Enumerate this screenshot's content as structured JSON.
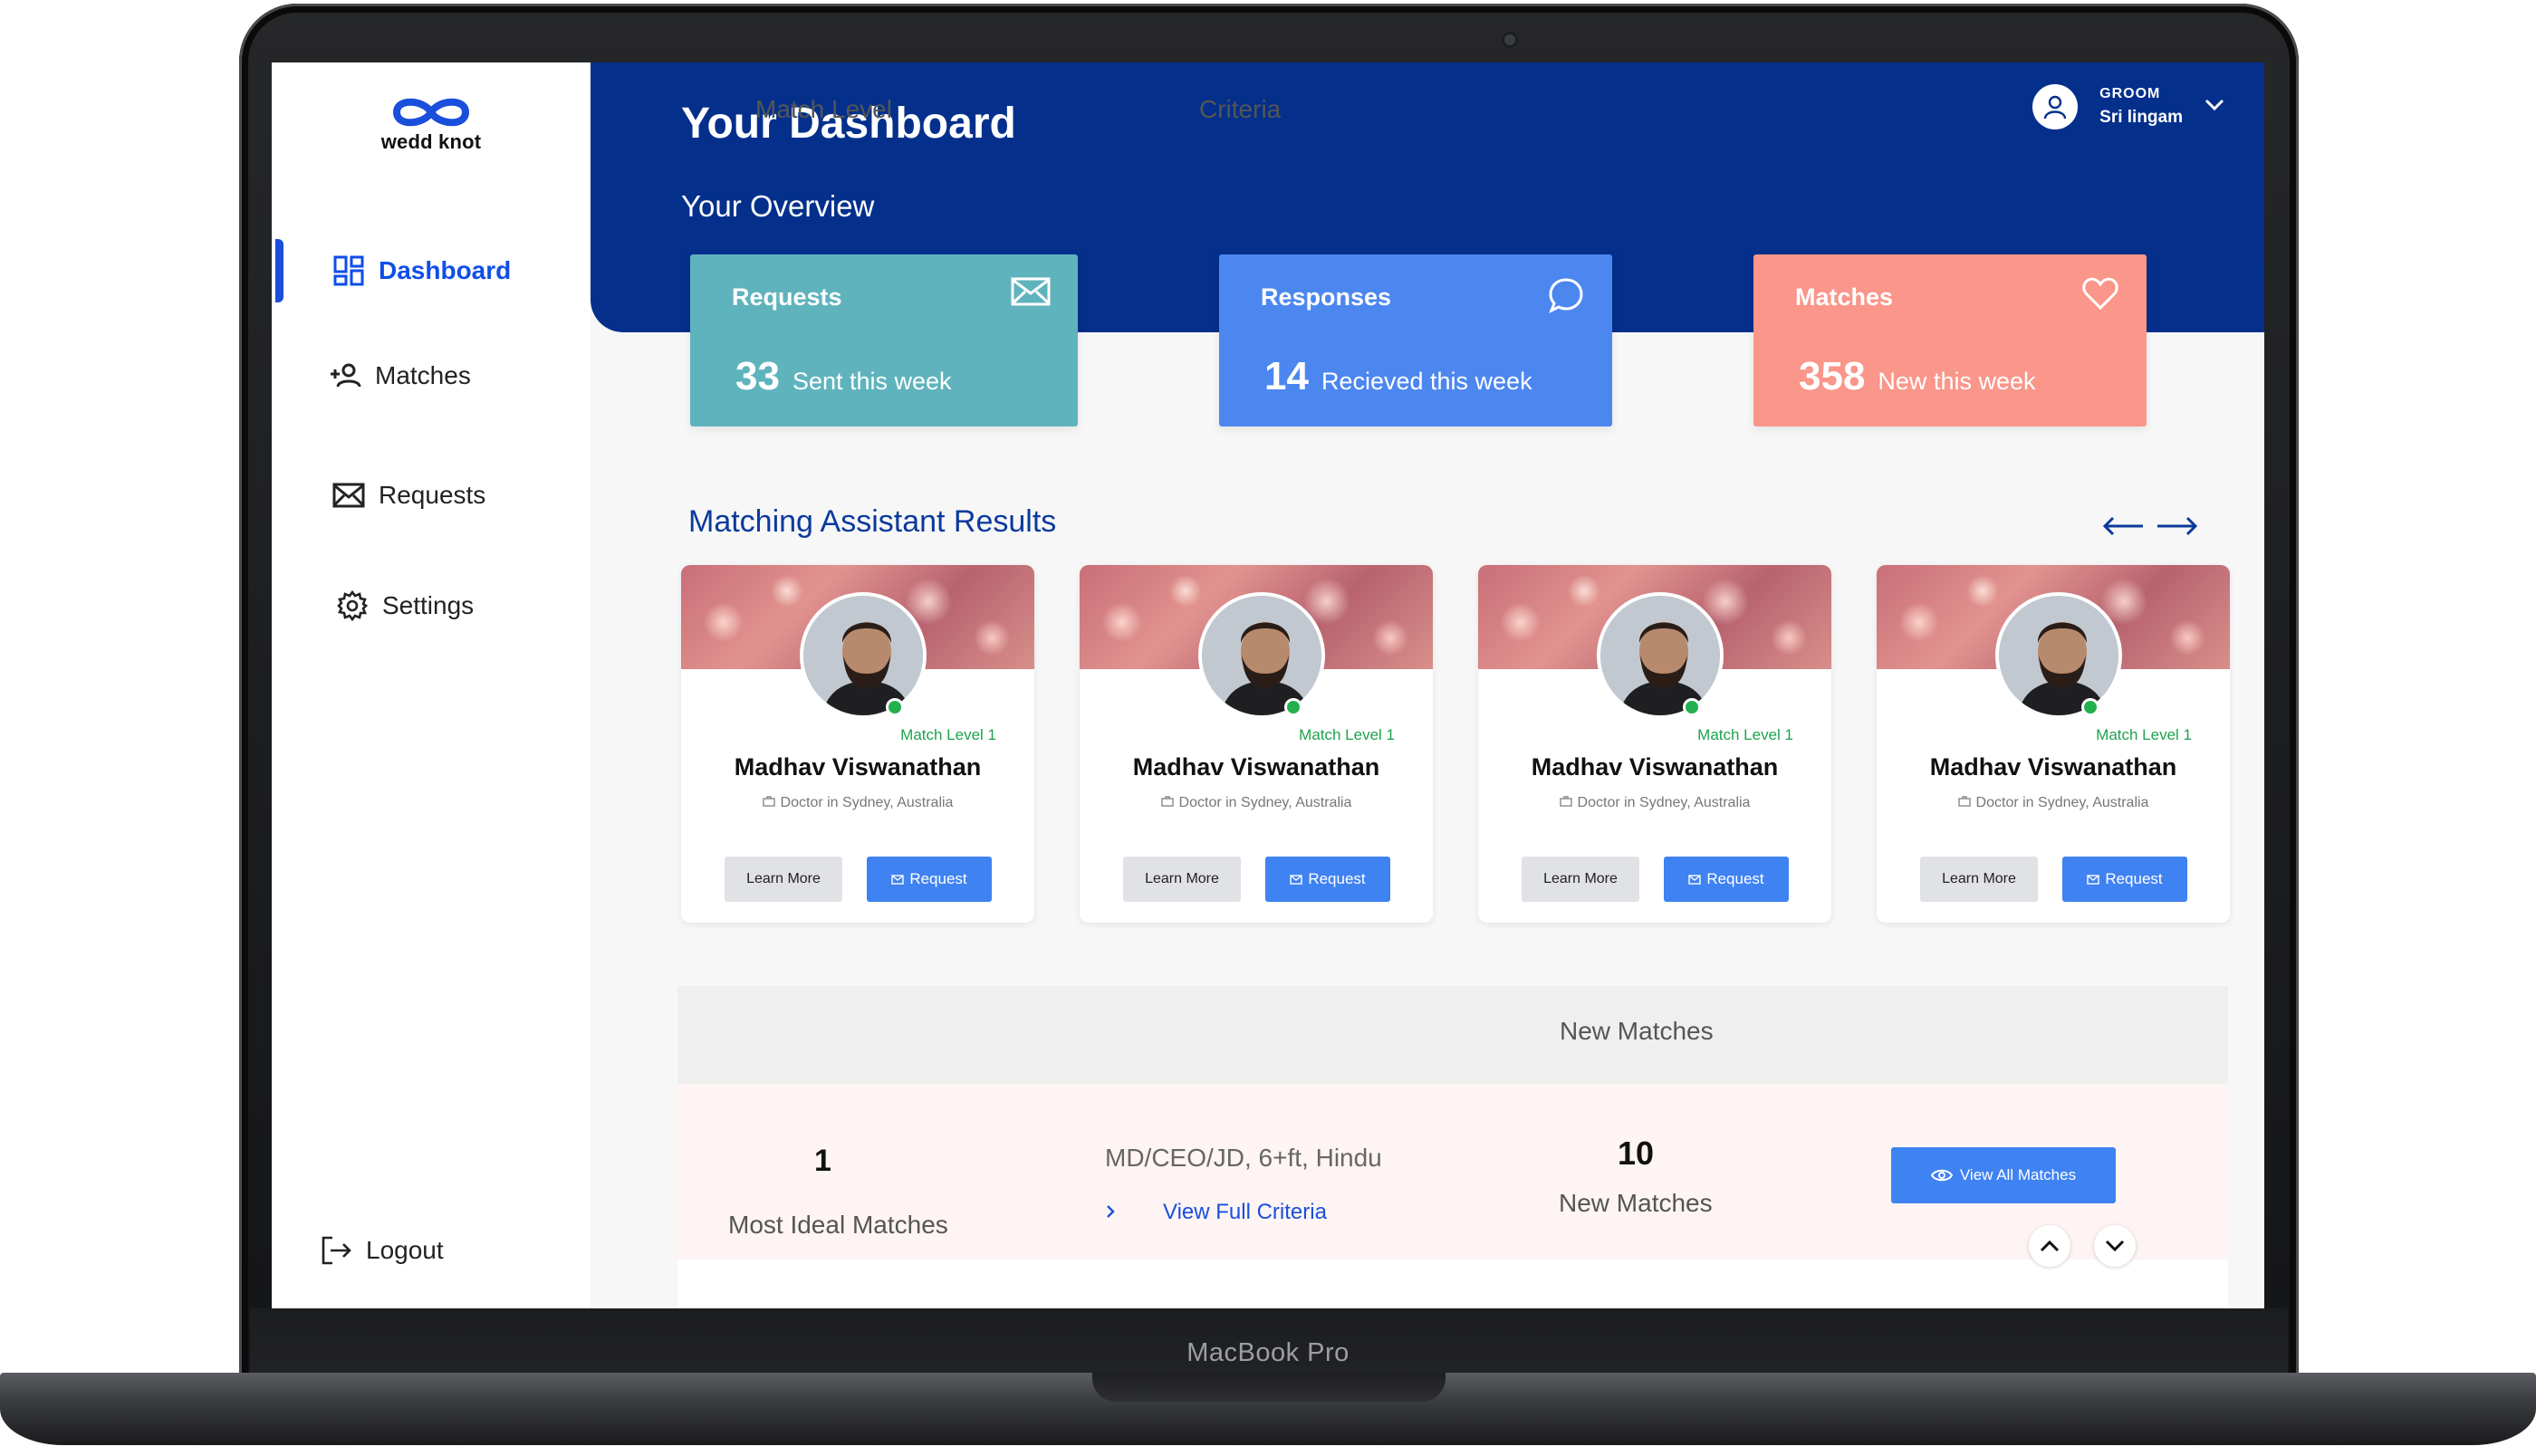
{
  "device": {
    "brand_label": "MacBook Pro"
  },
  "app": {
    "logo_text": "wedd knot"
  },
  "sidebar": {
    "items": [
      {
        "label": "Dashboard",
        "icon": "dashboard-icon",
        "active": true
      },
      {
        "label": "Matches",
        "icon": "add-user-icon"
      },
      {
        "label": "Requests",
        "icon": "envelope-icon"
      },
      {
        "label": "Settings",
        "icon": "gear-icon"
      }
    ],
    "logout_label": "Logout"
  },
  "header": {
    "title": "Your Dashboard",
    "subtitle": "Your Overview",
    "user": {
      "role": "GROOM",
      "name": "Sri lingam"
    }
  },
  "stats": [
    {
      "title": "Requests",
      "value": "33",
      "label": "Sent this week",
      "color": "#5fb3bd",
      "icon": "envelope-icon"
    },
    {
      "title": "Responses",
      "value": "14",
      "label": "Recieved this week",
      "color": "#4c87f0",
      "icon": "chat-bubble-icon"
    },
    {
      "title": "Matches",
      "value": "358",
      "label": "New this week",
      "color": "#fa968a",
      "icon": "heart-icon"
    }
  ],
  "matching": {
    "title": "Matching Assistant Results",
    "cards": [
      {
        "match_level": "Match Level 1",
        "name": "Madhav Viswanathan",
        "subtitle": "Doctor in Sydney, Australia",
        "learn_label": "Learn More",
        "request_label": "Request"
      },
      {
        "match_level": "Match Level 1",
        "name": "Madhav Viswanathan",
        "subtitle": "Doctor in Sydney, Australia",
        "learn_label": "Learn More",
        "request_label": "Request"
      },
      {
        "match_level": "Match Level 1",
        "name": "Madhav Viswanathan",
        "subtitle": "Doctor in Sydney, Australia",
        "learn_label": "Learn More",
        "request_label": "Request"
      },
      {
        "match_level": "Match Level 1",
        "name": "Madhav Viswanathan",
        "subtitle": "Doctor in Sydney, Australia",
        "learn_label": "Learn More",
        "request_label": "Request"
      }
    ]
  },
  "table": {
    "headers": [
      "Match Level",
      "Criteria",
      "New Matches"
    ],
    "rows": [
      {
        "level": "1",
        "level_desc": "Most Ideal Matches",
        "criteria": "MD/CEO/JD,  6+ft, Hindu",
        "criteria_link": "View Full Criteria",
        "new_count": "10",
        "new_label": "New Matches",
        "action_label": "View All Matches"
      }
    ]
  },
  "colors": {
    "hero": "#04308c",
    "accent": "#1a4fdc",
    "button": "#3f82f2",
    "online": "#23b04f"
  }
}
